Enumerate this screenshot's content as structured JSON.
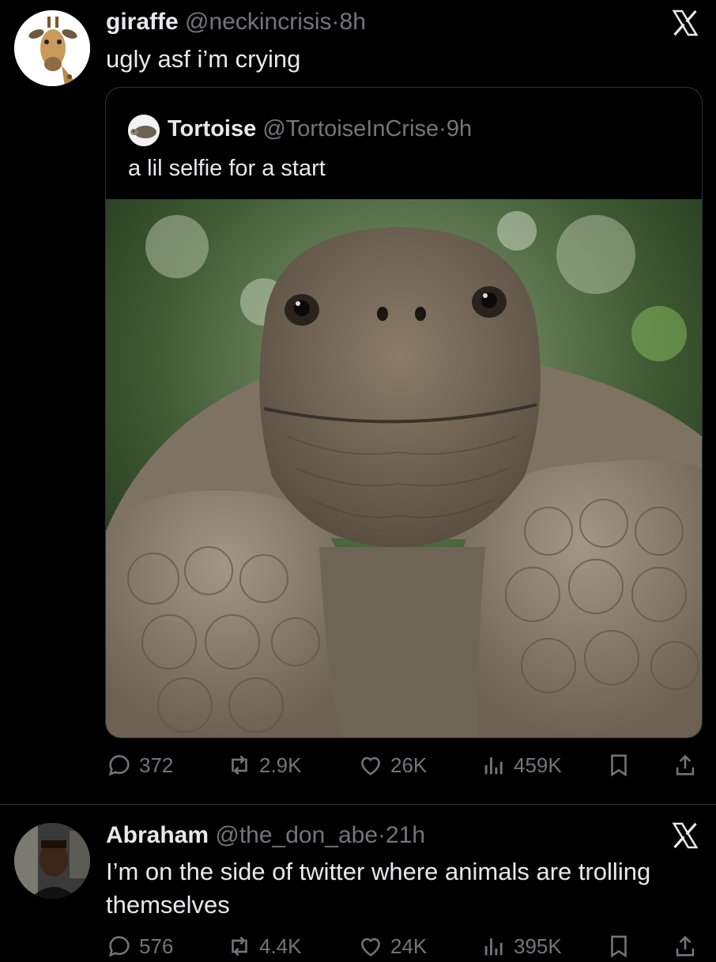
{
  "tweets": [
    {
      "name": "giraffe",
      "handle": "@neckincrisis",
      "separator": "·",
      "time": "8h",
      "text": "ugly asf i’m crying",
      "quote": {
        "name": "Tortoise",
        "handle": "@TortoiseInCrise",
        "separator": "·",
        "time": "9h",
        "text": "a lil selfie for a start"
      },
      "stats": {
        "replies": "372",
        "reposts": "2.9K",
        "likes": "26K",
        "views": "459K"
      }
    },
    {
      "name": "Abraham",
      "handle": "@the_don_abe",
      "separator": "·",
      "time": "21h",
      "text": "I’m on the side of twitter where animals are trolling themselves",
      "stats": {
        "replies": "576",
        "reposts": "4.4K",
        "likes": "24K",
        "views": "395K"
      }
    }
  ],
  "colors": {
    "background": "#000000",
    "text": "#e7e9ea",
    "muted": "#71767b",
    "border": "#2f3336"
  },
  "icons": [
    "x-logo-icon",
    "reply-icon",
    "repost-icon",
    "like-icon",
    "views-icon",
    "bookmark-icon",
    "share-icon"
  ]
}
